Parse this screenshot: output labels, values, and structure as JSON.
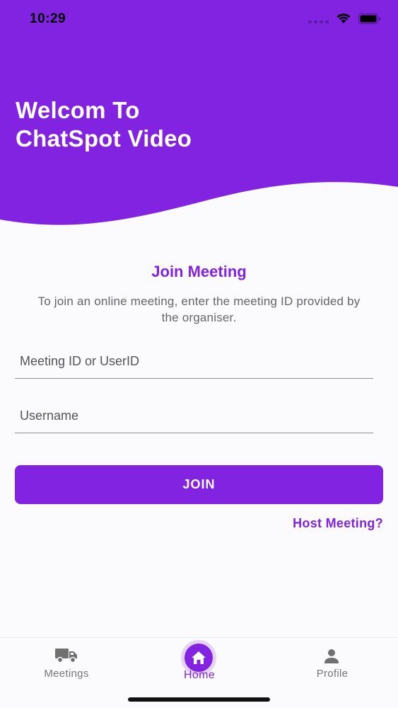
{
  "status_bar": {
    "time": "10:29"
  },
  "header": {
    "title_line1": "Welcom To",
    "title_line2": "ChatSpot Video"
  },
  "form": {
    "title": "Join Meeting",
    "description": "To join an online meeting, enter the meeting ID provided by the organiser.",
    "meeting_id_placeholder": "Meeting ID or UserID",
    "meeting_id_value": "",
    "username_placeholder": "Username",
    "username_value": "",
    "join_label": "JOIN",
    "host_link": "Host Meeting?"
  },
  "tabs": [
    {
      "label": "Meetings",
      "icon": "truck-icon",
      "active": false
    },
    {
      "label": "Home",
      "icon": "home-icon",
      "active": true
    },
    {
      "label": "Profile",
      "icon": "person-icon",
      "active": false
    }
  ],
  "colors": {
    "accent": "#8123e0",
    "background": "#fbfafc",
    "inactive_tab": "#777777"
  }
}
